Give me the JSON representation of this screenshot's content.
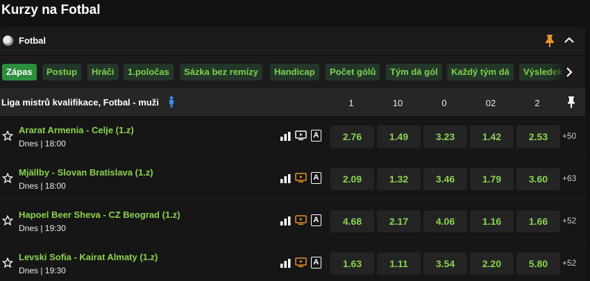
{
  "page": {
    "title": "Kurzy na Fotbal"
  },
  "sport": {
    "name": "Fotbal",
    "ball_icon": "soccer-ball-icon",
    "pin_icon": "pin-icon",
    "pin_color": "#e8922b",
    "collapse_icon": "chevron-up-icon"
  },
  "tabs": [
    {
      "label": "Zápas",
      "active": true
    },
    {
      "label": "Postup",
      "active": false
    },
    {
      "label": "Hráči",
      "active": false
    },
    {
      "label": "1.poločas",
      "active": false
    },
    {
      "label": "Sázka bez remízy",
      "active": false
    },
    {
      "label": "Handicap",
      "active": false
    },
    {
      "label": "Počet gólů",
      "active": false
    },
    {
      "label": "Tým dá gól",
      "active": false
    },
    {
      "label": "Každý tým dá",
      "active": false
    },
    {
      "label": "Výsledek",
      "active": false
    }
  ],
  "league": {
    "name": "Liga mistrů kvalifikace, Fotbal - muži",
    "columns": [
      "1",
      "10",
      "0",
      "02",
      "2"
    ]
  },
  "matches": [
    {
      "name": "Ararat Armenia - Celje (1.z)",
      "time": "Dnes | 18:00",
      "odds": [
        "2.76",
        "1.49",
        "3.23",
        "1.42",
        "2.53"
      ],
      "more": "+50",
      "tv_live": false
    },
    {
      "name": "Mjällby - Slovan Bratislava (1.z)",
      "time": "Dnes | 18:00",
      "odds": [
        "2.09",
        "1.32",
        "3.46",
        "1.79",
        "3.60"
      ],
      "more": "+63",
      "tv_live": true
    },
    {
      "name": "Hapoel Beer Sheva - CZ Beograd (1.z)",
      "time": "Dnes | 19:30",
      "odds": [
        "4.68",
        "2.17",
        "4.06",
        "1.16",
        "1.66"
      ],
      "more": "+52",
      "tv_live": true
    },
    {
      "name": "Levski Sofia - Kairat Almaty (1.z)",
      "time": "Dnes | 19:30",
      "odds": [
        "1.63",
        "1.11",
        "3.54",
        "2.20",
        "5.80"
      ],
      "more": "+52",
      "tv_live": true
    }
  ],
  "colors": {
    "accent_green": "#8bd44e",
    "active_tab": "#2c8f3d",
    "tv_orange": "#e8922b",
    "person_blue": "#3a8ee6"
  }
}
